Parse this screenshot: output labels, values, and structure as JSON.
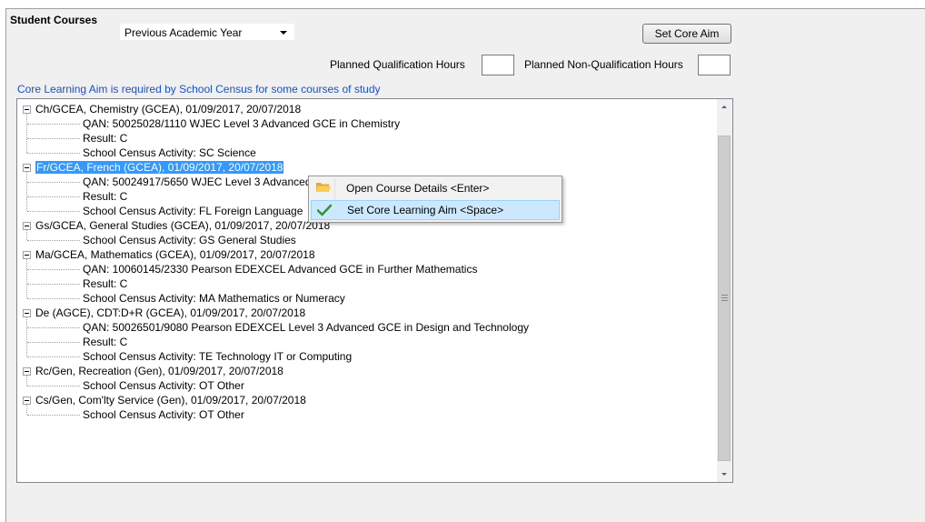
{
  "header": {
    "title": "Student Courses",
    "year_select": "Previous Academic Year",
    "set_core_aim_button": "Set Core Aim",
    "planned_qual_hours_label": "Planned Qualification Hours",
    "planned_qual_hours_value": "",
    "planned_nonqual_hours_label": "Planned Non-Qualification Hours",
    "planned_nonqual_hours_value": ""
  },
  "info": "Core Learning Aim is required by School Census for some courses of study",
  "tree": {
    "courses": [
      {
        "label": "Ch/GCEA, Chemistry (GCEA), 01/09/2017, 20/07/2018",
        "selected": false,
        "children": [
          "QAN: 50025028/1110 WJEC Level 3 Advanced GCE in Chemistry",
          "Result: C",
          "School Census Activity: SC Science"
        ]
      },
      {
        "label": "Fr/GCEA, French (GCEA), 01/09/2017, 20/07/2018",
        "selected": true,
        "children": [
          "QAN: 50024917/5650 WJEC Level 3 Advanced GCE in French",
          "Result: C",
          "School Census Activity: FL Foreign Language"
        ]
      },
      {
        "label": "Gs/GCEA, General Studies (GCEA), 01/09/2017, 20/07/2018",
        "selected": false,
        "children": [
          "School Census Activity: GS General Studies"
        ]
      },
      {
        "label": "Ma/GCEA, Mathematics (GCEA), 01/09/2017, 20/07/2018",
        "selected": false,
        "children": [
          "QAN: 10060145/2330 Pearson EDEXCEL Advanced GCE in Further Mathematics",
          "Result: C",
          "School Census Activity: MA Mathematics or Numeracy"
        ]
      },
      {
        "label": "De (AGCE), CDT:D+R (GCEA), 01/09/2017, 20/07/2018",
        "selected": false,
        "children": [
          "QAN: 50026501/9080 Pearson EDEXCEL Level 3 Advanced GCE in Design and Technology",
          "Result: C",
          "School Census Activity: TE Technology IT or Computing"
        ]
      },
      {
        "label": "Rc/Gen, Recreation (Gen), 01/09/2017, 20/07/2018",
        "selected": false,
        "children": [
          "School Census Activity: OT Other"
        ]
      },
      {
        "label": "Cs/Gen, Com'lty Service (Gen), 01/09/2017, 20/07/2018",
        "selected": false,
        "children": [
          "School Census Activity: OT Other"
        ]
      }
    ]
  },
  "context_menu": {
    "items": [
      {
        "label": "Open Course Details <Enter>",
        "icon": "folder-icon",
        "highlighted": false
      },
      {
        "label": "Set Core Learning Aim <Space>",
        "icon": "checkmark-icon",
        "highlighted": true
      }
    ]
  }
}
